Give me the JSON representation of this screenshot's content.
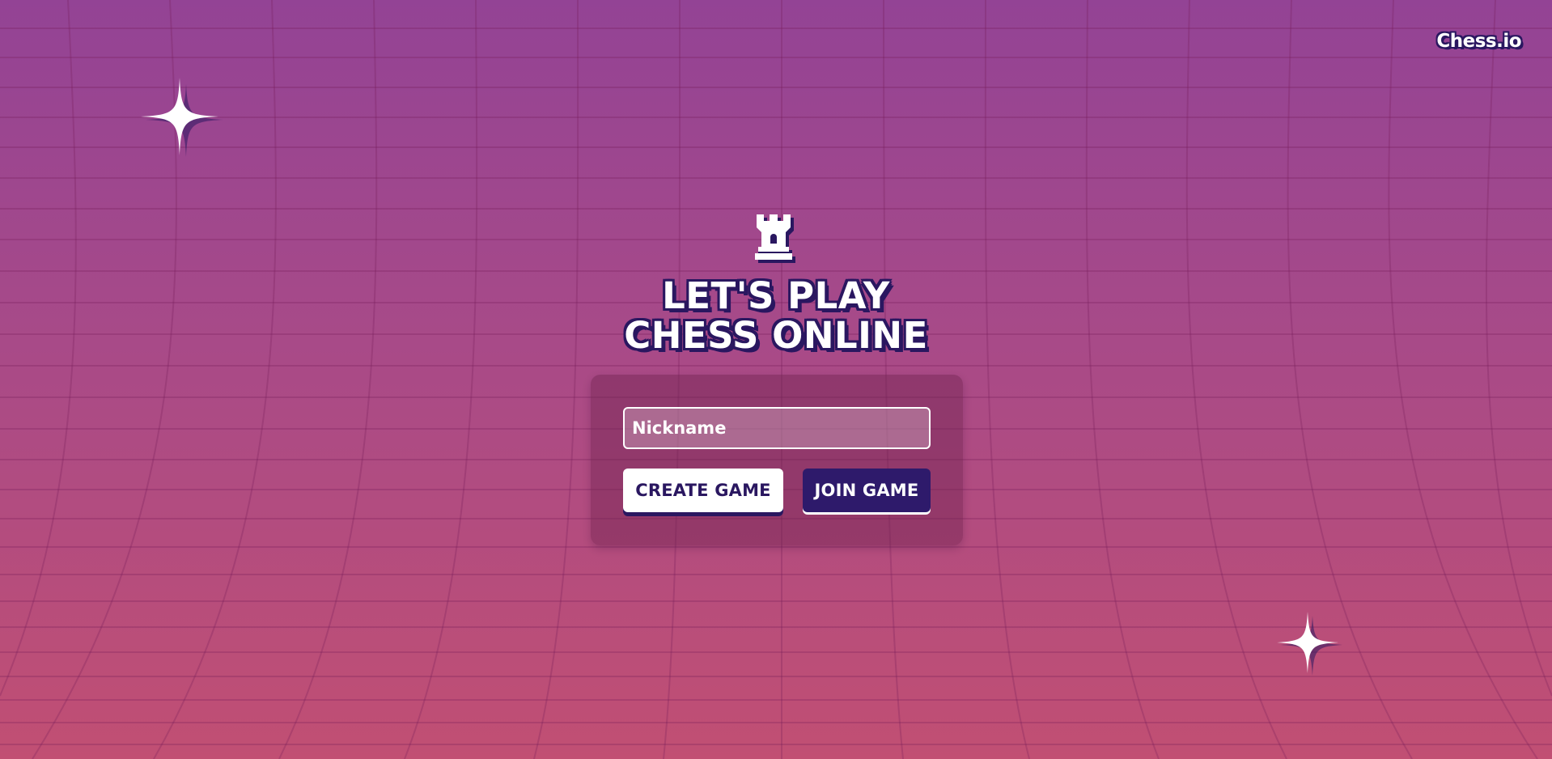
{
  "header": {
    "brand": "Chess.io"
  },
  "hero": {
    "icon": "chess-rook-icon",
    "title_line_1": "LET'S PLAY",
    "title_line_2": "CHESS ONLINE"
  },
  "form": {
    "nickname_placeholder": "Nickname",
    "nickname_value": "",
    "create_label": "CREATE GAME",
    "join_label": "JOIN GAME"
  },
  "decorations": {
    "sparkle_icon": "sparkle-icon"
  },
  "colors": {
    "background_top": "#934395",
    "background_bottom": "#c14f73",
    "outline_dark": "#2a1760",
    "join_button": "#2e1a6b",
    "text_light": "#ffffff"
  }
}
